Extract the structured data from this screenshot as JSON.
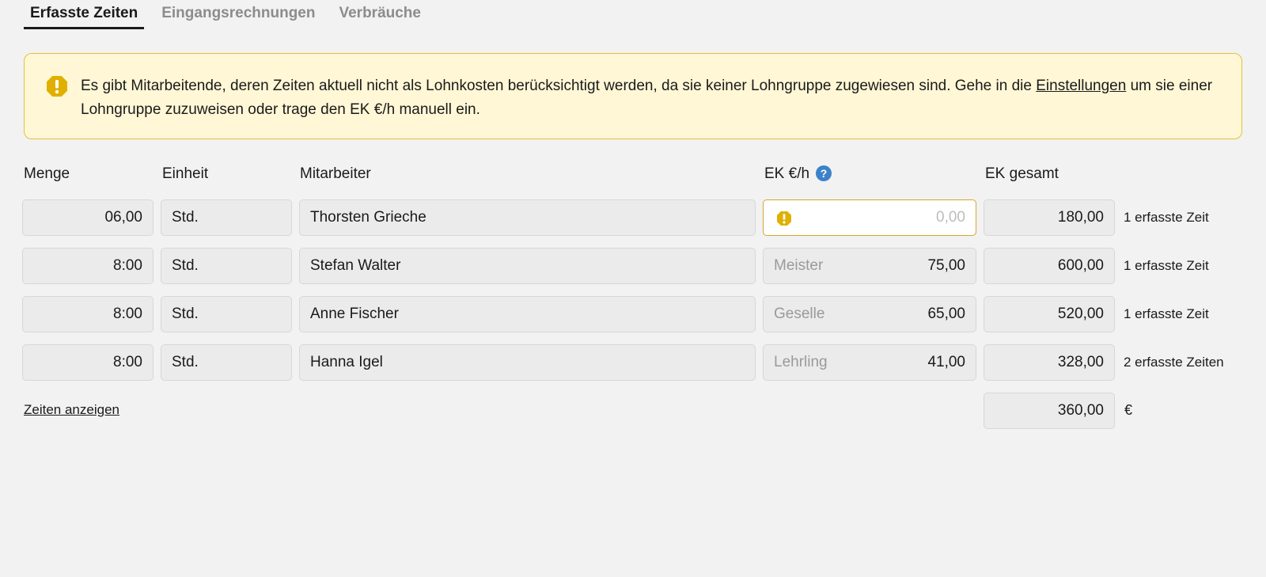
{
  "tabs": [
    {
      "label": "Erfasste Zeiten",
      "active": true
    },
    {
      "label": "Eingangsrechnungen",
      "active": false
    },
    {
      "label": "Verbräuche",
      "active": false
    }
  ],
  "banner": {
    "icon": "warning-icon",
    "text_before": "Es gibt Mitarbeitende, deren Zeiten aktuell nicht als Lohnkosten berücksichtigt werden, da sie keiner Lohngruppe zugewiesen sind. Gehe in die ",
    "link_label": "Einstellungen",
    "text_after": " um sie einer Lohngruppe zuzuweisen oder trage den EK €/h manuell ein.",
    "colors": {
      "background": "#fff7d6",
      "border": "#e3c13b",
      "icon": "#e0b000"
    }
  },
  "columns": {
    "menge": "Menge",
    "einheit": "Einheit",
    "mitarbeiter": "Mitarbeiter",
    "ek": "EK €/h",
    "ek_help_icon": "question-icon",
    "ek_gesamt": "EK gesamt"
  },
  "rows": [
    {
      "menge": "06,00",
      "einheit": "Std.",
      "mitarbeiter": "Thorsten Grieche",
      "gruppe": "",
      "ek": "",
      "ek_placeholder": "0,00",
      "warning": true,
      "gesamt": "180,00",
      "count": "1 erfasste Zeit"
    },
    {
      "menge": "8:00",
      "einheit": "Std.",
      "mitarbeiter": "Stefan Walter",
      "gruppe": "Meister",
      "ek": "75,00",
      "ek_placeholder": "",
      "warning": false,
      "gesamt": "600,00",
      "count": "1 erfasste Zeit"
    },
    {
      "menge": "8:00",
      "einheit": "Std.",
      "mitarbeiter": "Anne Fischer",
      "gruppe": "Geselle",
      "ek": "65,00",
      "ek_placeholder": "",
      "warning": false,
      "gesamt": "520,00",
      "count": "1 erfasste Zeit"
    },
    {
      "menge": "8:00",
      "einheit": "Std.",
      "mitarbeiter": "Hanna Igel",
      "gruppe": "Lehrling",
      "ek": "41,00",
      "ek_placeholder": "",
      "warning": false,
      "gesamt": "328,00",
      "count": "2 erfasste Zeiten"
    }
  ],
  "footer": {
    "link_label": "Zeiten anzeigen",
    "total": "360,00",
    "currency": "€"
  }
}
